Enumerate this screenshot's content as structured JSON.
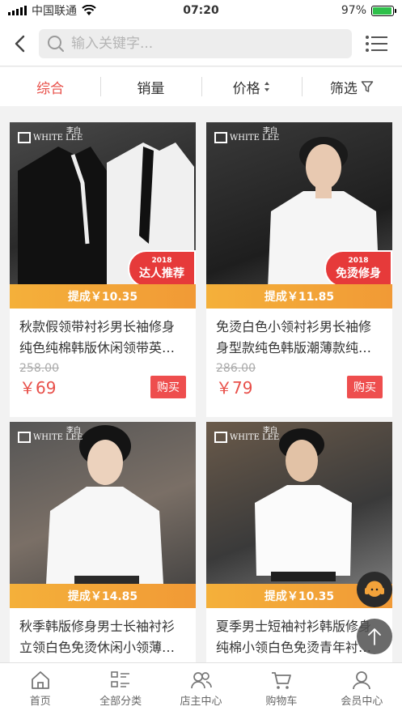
{
  "status": {
    "carrier": "中国联通",
    "time": "07:20",
    "battery": "97%",
    "battery_level": 0.97
  },
  "search": {
    "placeholder": "输入关键字..."
  },
  "sort_tabs": [
    {
      "label": "综合",
      "active": true
    },
    {
      "label": "销量",
      "active": false
    },
    {
      "label": "价格",
      "active": false
    },
    {
      "label": "筛选",
      "active": false
    }
  ],
  "products": [
    {
      "brand": "WHITE LEE",
      "brand_cn": "李白",
      "badge_year": "2018",
      "badge": "达人推荐",
      "commission": "提成￥10.35",
      "title": "秋款假领带衬衫男长袖修身纯色纯棉韩版休闲领带英…",
      "orig_price": "258.00",
      "price": "￥69",
      "buy": "购买"
    },
    {
      "brand": "WHITE LEE",
      "brand_cn": "李白",
      "badge_year": "2018",
      "badge": "免烫修身",
      "commission": "提成￥11.85",
      "title": "免烫白色小领衬衫男长袖修身型款纯色韩版潮薄款纯…",
      "orig_price": "286.00",
      "price": "￥79",
      "buy": "购买"
    },
    {
      "brand": "WHITE LEE",
      "brand_cn": "李白",
      "commission": "提成￥14.85",
      "title": "秋季韩版修身男士长袖衬衫立领白色免烫休闲小领薄…"
    },
    {
      "brand": "WHITE LEE",
      "brand_cn": "李白",
      "commission": "提成￥10.35",
      "title": "夏季男士短袖衬衫韩版修身纯棉小领白色免烫青年衬…"
    }
  ],
  "tabbar": [
    {
      "label": "首页",
      "icon": "home-icon"
    },
    {
      "label": "全部分类",
      "icon": "category-icon"
    },
    {
      "label": "店主中心",
      "icon": "shop-owner-icon"
    },
    {
      "label": "购物车",
      "icon": "cart-icon"
    },
    {
      "label": "会员中心",
      "icon": "member-icon"
    }
  ],
  "colors": {
    "accent": "#e8504a",
    "commission": "#f4a83a",
    "buy": "#ee4e4e"
  }
}
